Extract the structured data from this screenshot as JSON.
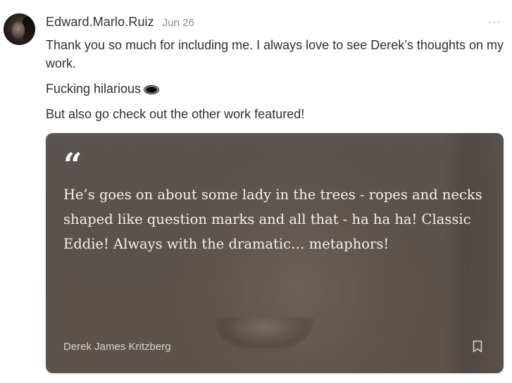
{
  "comment": {
    "author": "Edward.Marlo.Ruiz",
    "date": "Jun 26",
    "more_label": "···",
    "paragraphs": [
      "Thank you so much for including me. I always love to see Derek’s thoughts on my work.",
      "Fucking hilarious",
      "But also go check out the other work featured!"
    ],
    "emoji_icon": "eye-emoji-icon"
  },
  "quote": {
    "mark": "“",
    "text": "He’s goes on about some lady in the trees - ropes and necks shaped like question marks and all that - ha ha ha! Classic Eddie! Always with the dramatic… metaphors!",
    "author": "Derek James Kritzberg",
    "bookmark_icon": "bookmark-icon"
  },
  "colors": {
    "card_background": "#5b544f",
    "quote_text": "#f4f1ee",
    "muted": "#8a8a8a"
  }
}
